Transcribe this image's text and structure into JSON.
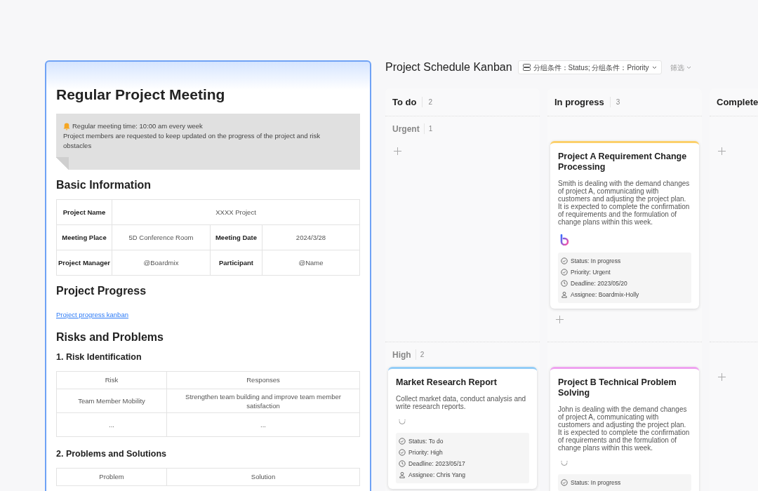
{
  "document": {
    "title": "Regular Project Meeting",
    "notice": {
      "headline": "Regular meeting time: 10:00 am every week",
      "body": "Project members are requested to keep updated on the progress of the project and risk obstacles"
    },
    "sections": [
      {
        "kind": "h2",
        "text": "Basic Information"
      },
      {
        "kind": "info_table",
        "rows": [
          [
            {
              "label": "Project Name",
              "value": "XXXX Project"
            }
          ],
          [
            {
              "label": "Meeting Place",
              "value": "5D Conference Room"
            },
            {
              "label": "Meeting Date",
              "value": "2024/3/28"
            }
          ],
          [
            {
              "label": "Project Manager",
              "value": "@Boardmix"
            },
            {
              "label": "Participant",
              "value": "@Name"
            }
          ]
        ]
      },
      {
        "kind": "h2",
        "text": "Project Progress"
      },
      {
        "kind": "link",
        "text": "Project progress kanban"
      },
      {
        "kind": "h2",
        "text": "Risks and Problems"
      },
      {
        "kind": "h3",
        "text": "1. Risk Identification"
      },
      {
        "kind": "table",
        "columns": [
          "Risk",
          "Responses"
        ],
        "rows": [
          [
            "Team Member Mobility",
            "Strengthen team building and improve team member satisfaction"
          ],
          [
            "...",
            "..."
          ]
        ]
      },
      {
        "kind": "h3",
        "text": "2. Problems and Solutions"
      },
      {
        "kind": "table",
        "columns": [
          "Problem",
          "Solution"
        ]
      }
    ]
  },
  "kanban": {
    "title": "Project Schedule Kanban",
    "group_by": "分组条件：Status; 分组条件：Priority",
    "filter": "筛选",
    "columns": [
      {
        "title": "To do",
        "count": "2"
      },
      {
        "title": "In progress",
        "count": "3"
      },
      {
        "title": "Complete"
      }
    ],
    "lanes": [
      {
        "label": "Urgent",
        "count": "1",
        "cells": [
          null,
          {
            "cards": [
              {
                "title": "Project A Requirement Change Processing",
                "color": "#fcd06b",
                "description": "Smith is dealing with the demand changes of project A, communicating with customers and adjusting the project plan. It is expected to complete the confirmation of requirements and the formulation of change plans within this week.",
                "kind": "logo",
                "fields": [
                  {
                    "kind": "check",
                    "text": "Status: In progress"
                  },
                  {
                    "kind": "check",
                    "text": "Priority: Urgent"
                  },
                  {
                    "kind": "clock",
                    "text": "Deadline: 2023/05/20"
                  },
                  {
                    "kind": "person",
                    "text": "Assignee: Boardmix-Holly"
                  }
                ]
              }
            ]
          },
          null
        ]
      },
      {
        "label": "High",
        "count": "2",
        "cells": [
          {
            "cards": [
              {
                "title": "Market Research Report",
                "color": "#93cdf7",
                "description": "Collect market data, conduct analysis and write research reports.",
                "kind": "plain",
                "fields": [
                  {
                    "kind": "check",
                    "text": "Status: To do"
                  },
                  {
                    "kind": "check",
                    "text": "Priority: High"
                  },
                  {
                    "kind": "clock",
                    "text": "Deadline: 2023/05/17"
                  },
                  {
                    "kind": "person",
                    "text": "Assignee: Chris Yang"
                  }
                ]
              }
            ]
          },
          {
            "cards": [
              {
                "title": "Project B Technical Problem Solving",
                "color": "#efa3f0",
                "description": "John is dealing with the demand changes of project A, communicating with customers and adjusting the project plan. It is expected to complete the confirmation of requirements and the formulation of change plans within this week.",
                "kind": "plain",
                "fields": [
                  {
                    "kind": "check",
                    "text": "Status: In progress"
                  }
                ]
              }
            ]
          },
          null
        ]
      }
    ]
  }
}
